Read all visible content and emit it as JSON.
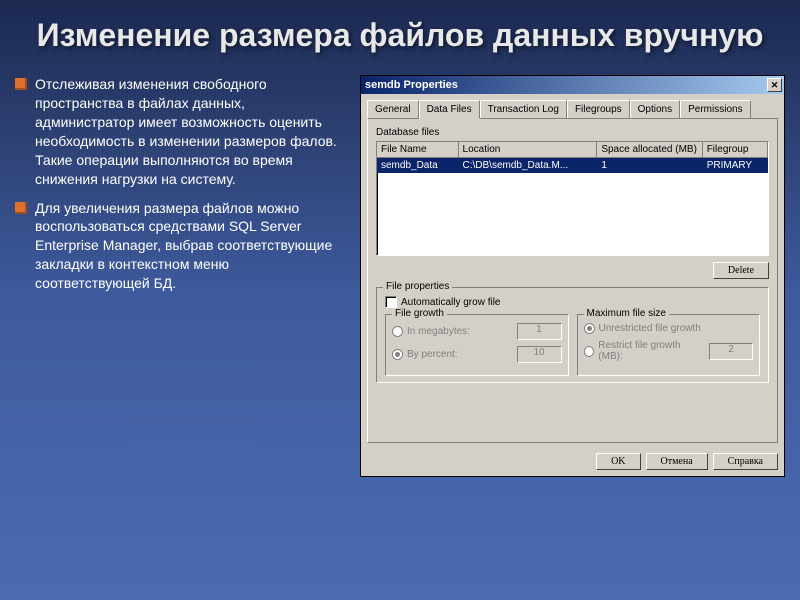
{
  "slide": {
    "title": "Изменение размера файлов данных вручную",
    "bullets": [
      "Отслеживая изменения свободного пространства в файлах данных, администратор имеет возможность оценить необходимость в изменении размеров фалов. Такие операции выполняются во время снижения нагрузки на систему.",
      "Для увеличения размера файлов можно воспользоваться средствами SQL Server Enterprise Manager, выбрав соответствующие закладки в контекстном меню соответствующей БД."
    ]
  },
  "dialog": {
    "title": "semdb Properties",
    "closeIcon": "✕",
    "tabs": [
      "General",
      "Data Files",
      "Transaction Log",
      "Filegroups",
      "Options",
      "Permissions"
    ],
    "activeTab": 1,
    "dbFilesLabel": "Database files",
    "columns": {
      "c1": "File Name",
      "c2": "Location",
      "c3": "Space allocated (MB)",
      "c4": "Filegroup"
    },
    "row": {
      "name": "semdb_Data",
      "location": "C:\\DB\\semdb_Data.M...",
      "space": "1",
      "group": "PRIMARY"
    },
    "deleteBtn": "Delete",
    "filePropsLabel": "File properties",
    "autoGrow": "Automatically grow file",
    "fileGrowthLabel": "File growth",
    "growth": {
      "megabytes": "In megabytes:",
      "percent": "By percent:",
      "megVal": "1",
      "pctVal": "10"
    },
    "maxSizeLabel": "Maximum file size",
    "maxSize": {
      "unrestricted": "Unrestricted file growth",
      "restrict": "Restrict file growth (MB):",
      "restrictVal": "2"
    },
    "btns": {
      "ok": "OK",
      "cancel": "Отмена",
      "help": "Справка"
    }
  }
}
